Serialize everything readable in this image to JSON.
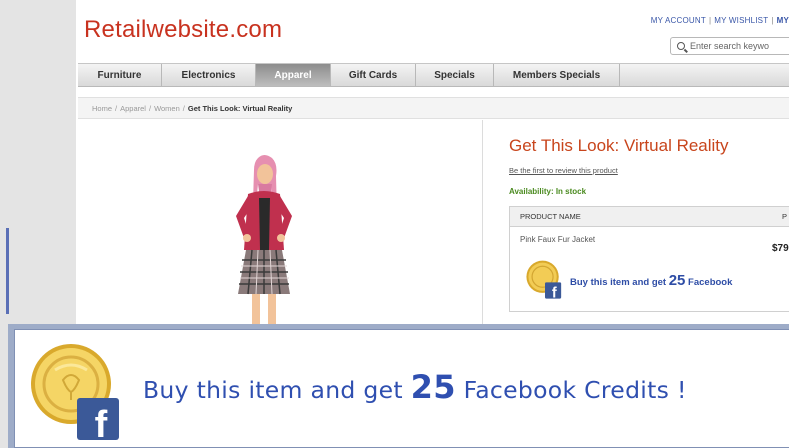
{
  "site": {
    "logo": "Retailwebsite.com",
    "top_links": [
      "MY ACCOUNT",
      "MY WISHLIST",
      "MY"
    ],
    "top_link_separator": "|",
    "search_placeholder": "Enter search keywo"
  },
  "nav": {
    "items": [
      {
        "label": "Furniture",
        "active": false
      },
      {
        "label": "Electronics",
        "active": false
      },
      {
        "label": "Apparel",
        "active": true
      },
      {
        "label": "Gift Cards",
        "active": false
      },
      {
        "label": "Specials",
        "active": false
      },
      {
        "label": "Members Specials",
        "active": false
      }
    ]
  },
  "breadcrumb": {
    "items": [
      "Home",
      "Apparel",
      "Women"
    ],
    "separator": "/",
    "current": "Get This Look: Virtual Reality"
  },
  "product": {
    "title": "Get This Look: Virtual Reality",
    "review_link": "Be the first to review this product",
    "availability": "Availability: In stock",
    "table_header_name": "PRODUCT NAME",
    "table_header_price": "P",
    "item_name": "Pink Faux Fur Jacket",
    "item_price": "$79"
  },
  "promo_small": {
    "prefix": "Buy this item and get ",
    "number": "25",
    "suffix": " Facebook"
  },
  "promo_banner": {
    "prefix": "Buy this item and get ",
    "number": "25",
    "suffix": " Facebook Credits !"
  },
  "icons": {
    "coin": "facebook-credits-coin-icon",
    "facebook": "facebook-f-icon",
    "search": "search-icon"
  },
  "colors": {
    "logo": "#c8321f",
    "title": "#c8451c",
    "link_blue": "#3a57a8",
    "promo_blue": "#2f4fb0",
    "in_stock_green": "#4a8a1f",
    "facebook_blue": "#3b5998",
    "coin_gold": "#e8c040"
  }
}
